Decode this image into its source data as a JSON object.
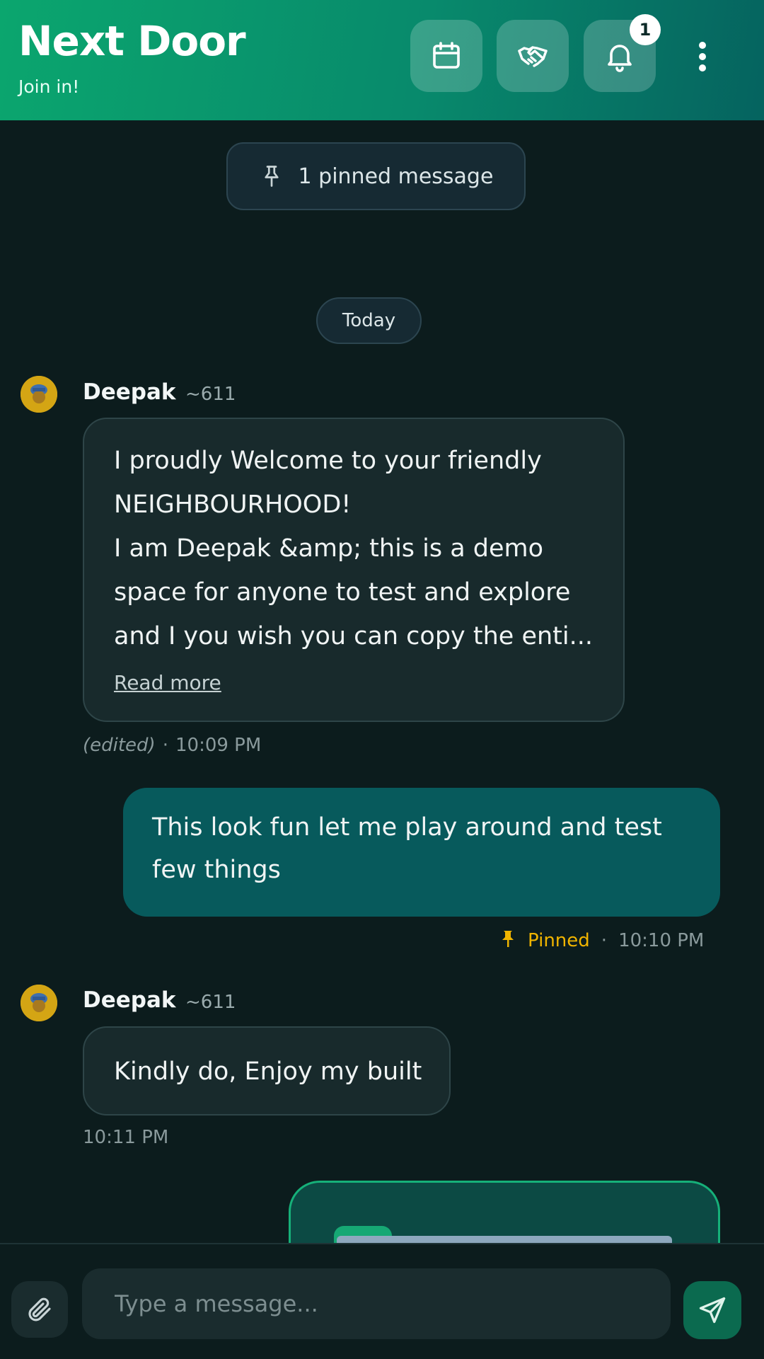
{
  "header": {
    "title": "Next Door",
    "subtitle": "Join in!",
    "buttons": [
      {
        "name": "calendar",
        "icon": "calendar-icon"
      },
      {
        "name": "handshake",
        "icon": "handshake-icon"
      },
      {
        "name": "notifications",
        "icon": "bell-icon"
      }
    ],
    "notification_count": "1",
    "more_icon": "more-vertical-icon"
  },
  "pinned_banner": {
    "icon": "pin-icon",
    "text": "1 pinned message"
  },
  "date_divider": "Today",
  "messages": [
    {
      "direction": "incoming",
      "sender": "Deepak",
      "sender_id": "~611",
      "text": "I proudly Welcome to your friendly\nNEIGHBOURHOOD!\nI am Deepak &amp; this is a demo\nspace for anyone to test and explore\nand I you wish you can copy the enti...",
      "read_more": "Read more",
      "edited": "(edited)",
      "time": "10:09 PM"
    },
    {
      "direction": "outgoing",
      "text": "This look fun let me play around and test\nfew things",
      "pinned_label": "Pinned",
      "time": "10:10 PM"
    },
    {
      "direction": "incoming",
      "sender": "Deepak",
      "sender_id": "~611",
      "text": "Kindly do, Enjoy my built",
      "time": "10:11 PM"
    }
  ],
  "composer": {
    "placeholder": "Type a message...",
    "attach_icon": "paperclip-icon",
    "send_icon": "send-icon"
  },
  "colors": {
    "header_gradient_start": "#0ba66e",
    "header_gradient_end": "#05635f",
    "background": "#0c1c1d",
    "incoming_bubble": "#182a2c",
    "outgoing_bubble": "#075a5c",
    "pinned_accent": "#f0b400",
    "send_button": "#0b6a4f"
  }
}
